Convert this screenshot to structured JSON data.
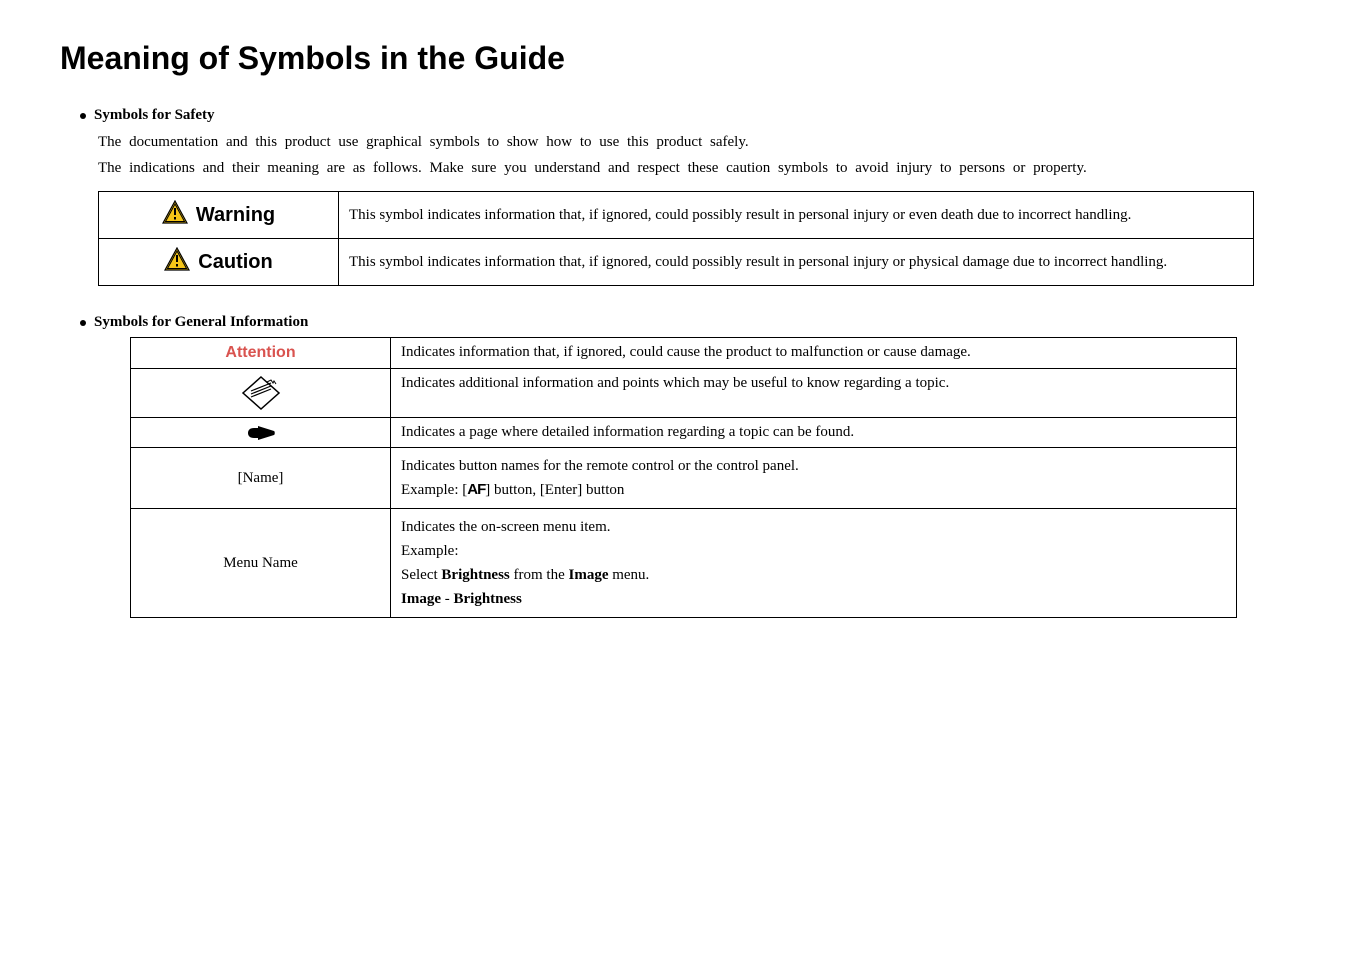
{
  "title": "Meaning of Symbols in the Guide",
  "section_safety": {
    "heading": "Symbols for Safety",
    "intro_line1": "The documentation and this product use graphical symbols to show how to use this product safely.",
    "intro_line2": "The indications and their meaning are as follows. Make sure you understand and respect these caution symbols to avoid injury to persons or property.",
    "rows": [
      {
        "label": "Warning",
        "desc": "This symbol indicates information that, if ignored, could possibly result in personal injury or even death due to incorrect handling."
      },
      {
        "label": "Caution",
        "desc": "This symbol indicates information that, if ignored, could possibly result in personal injury or physical damage due to incorrect handling."
      }
    ]
  },
  "section_info": {
    "heading": "Symbols for General Information",
    "rows": {
      "attention": {
        "label": "Attention",
        "desc": "Indicates information that, if ignored, could cause the product to malfunction or cause damage."
      },
      "tip": {
        "desc": "Indicates additional information and points which may be useful to know regarding a topic."
      },
      "hand": {
        "desc": "Indicates a page where detailed information regarding a topic can be found."
      },
      "name": {
        "label": "[Name]",
        "desc_line1": "Indicates button names for the remote control or the control panel.",
        "desc_prefix": "Example: [",
        "desc_af": "AF",
        "desc_suffix": "] button, [Enter] button"
      },
      "menu": {
        "label": "Menu Name",
        "line1": "Indicates the on-screen menu item.",
        "line2": "Example:",
        "line3a": "Select ",
        "line3b": "Brightness",
        "line3c": " from the ",
        "line3d": "Image",
        "line3e": " menu.",
        "line4a": "Image",
        "line4b": " - ",
        "line4c": "Brightness"
      }
    }
  }
}
